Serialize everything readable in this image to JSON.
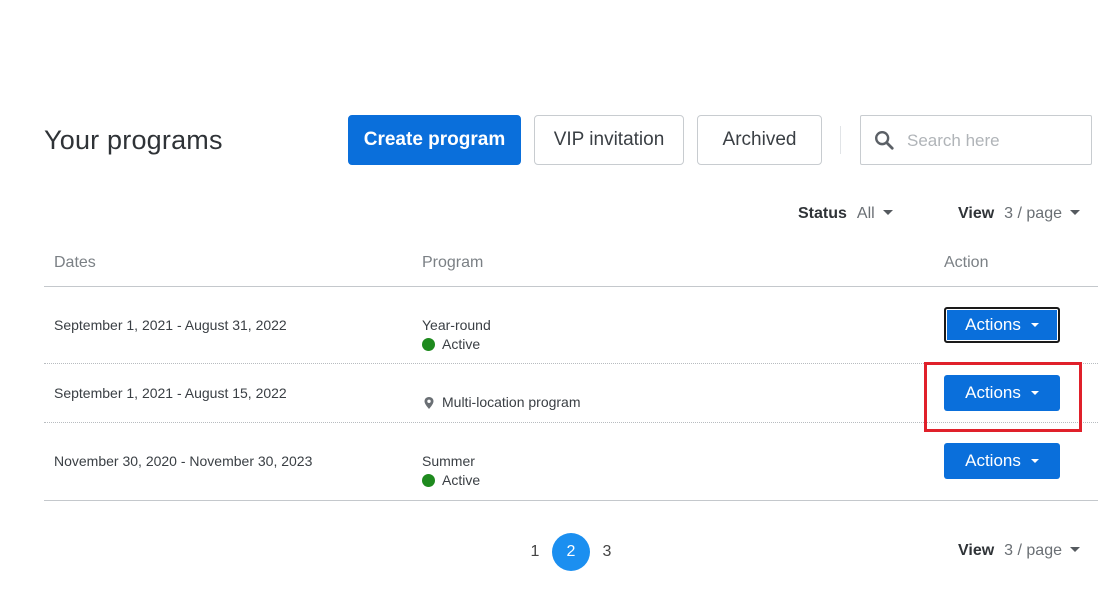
{
  "header": {
    "title": "Your programs",
    "create_label": "Create program",
    "vip_label": "VIP invitation",
    "archived_label": "Archived",
    "search_placeholder": "Search here"
  },
  "filters": {
    "status_label": "Status",
    "status_value": "All",
    "view_label": "View",
    "view_value": "3 / page"
  },
  "table": {
    "columns": [
      "Dates",
      "Program",
      "Action"
    ],
    "rows": [
      {
        "dates": "September 1, 2021 - August 31, 2022",
        "program": "Year-round",
        "status": "Active",
        "action": "Actions"
      },
      {
        "dates": "September 1, 2021 - August 15, 2022",
        "program": "Multi-location program",
        "status": "",
        "action": "Actions"
      },
      {
        "dates": "November 30, 2020 - November 30, 2023",
        "program": "Summer",
        "status": "Active",
        "action": "Actions"
      }
    ]
  },
  "pagination": {
    "pages": [
      "1",
      "2",
      "3"
    ],
    "current": "2",
    "view_label": "View",
    "view_value": "3 / page"
  },
  "colors": {
    "primary": "#0a6fdb",
    "active_status": "#1e8a1e",
    "current_page": "#1b8ff0",
    "highlight": "#e0202a"
  }
}
